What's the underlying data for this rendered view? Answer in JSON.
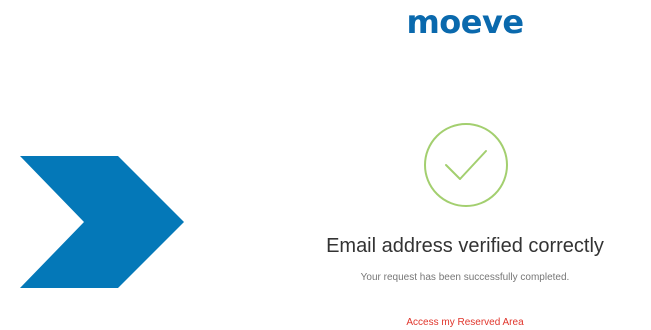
{
  "brand": {
    "logo_text": "moeve",
    "color": "#0a69ad"
  },
  "decoration": {
    "chevron_color": "#0478b8",
    "icon": "chevron-right-icon"
  },
  "status": {
    "icon": "check-circle-icon",
    "icon_color": "#a3cf6f",
    "title": "Email address verified correctly",
    "message": "Your request has been successfully completed."
  },
  "actions": {
    "reserved_area_link": "Access my Reserved Area",
    "link_color": "#e0352b"
  }
}
